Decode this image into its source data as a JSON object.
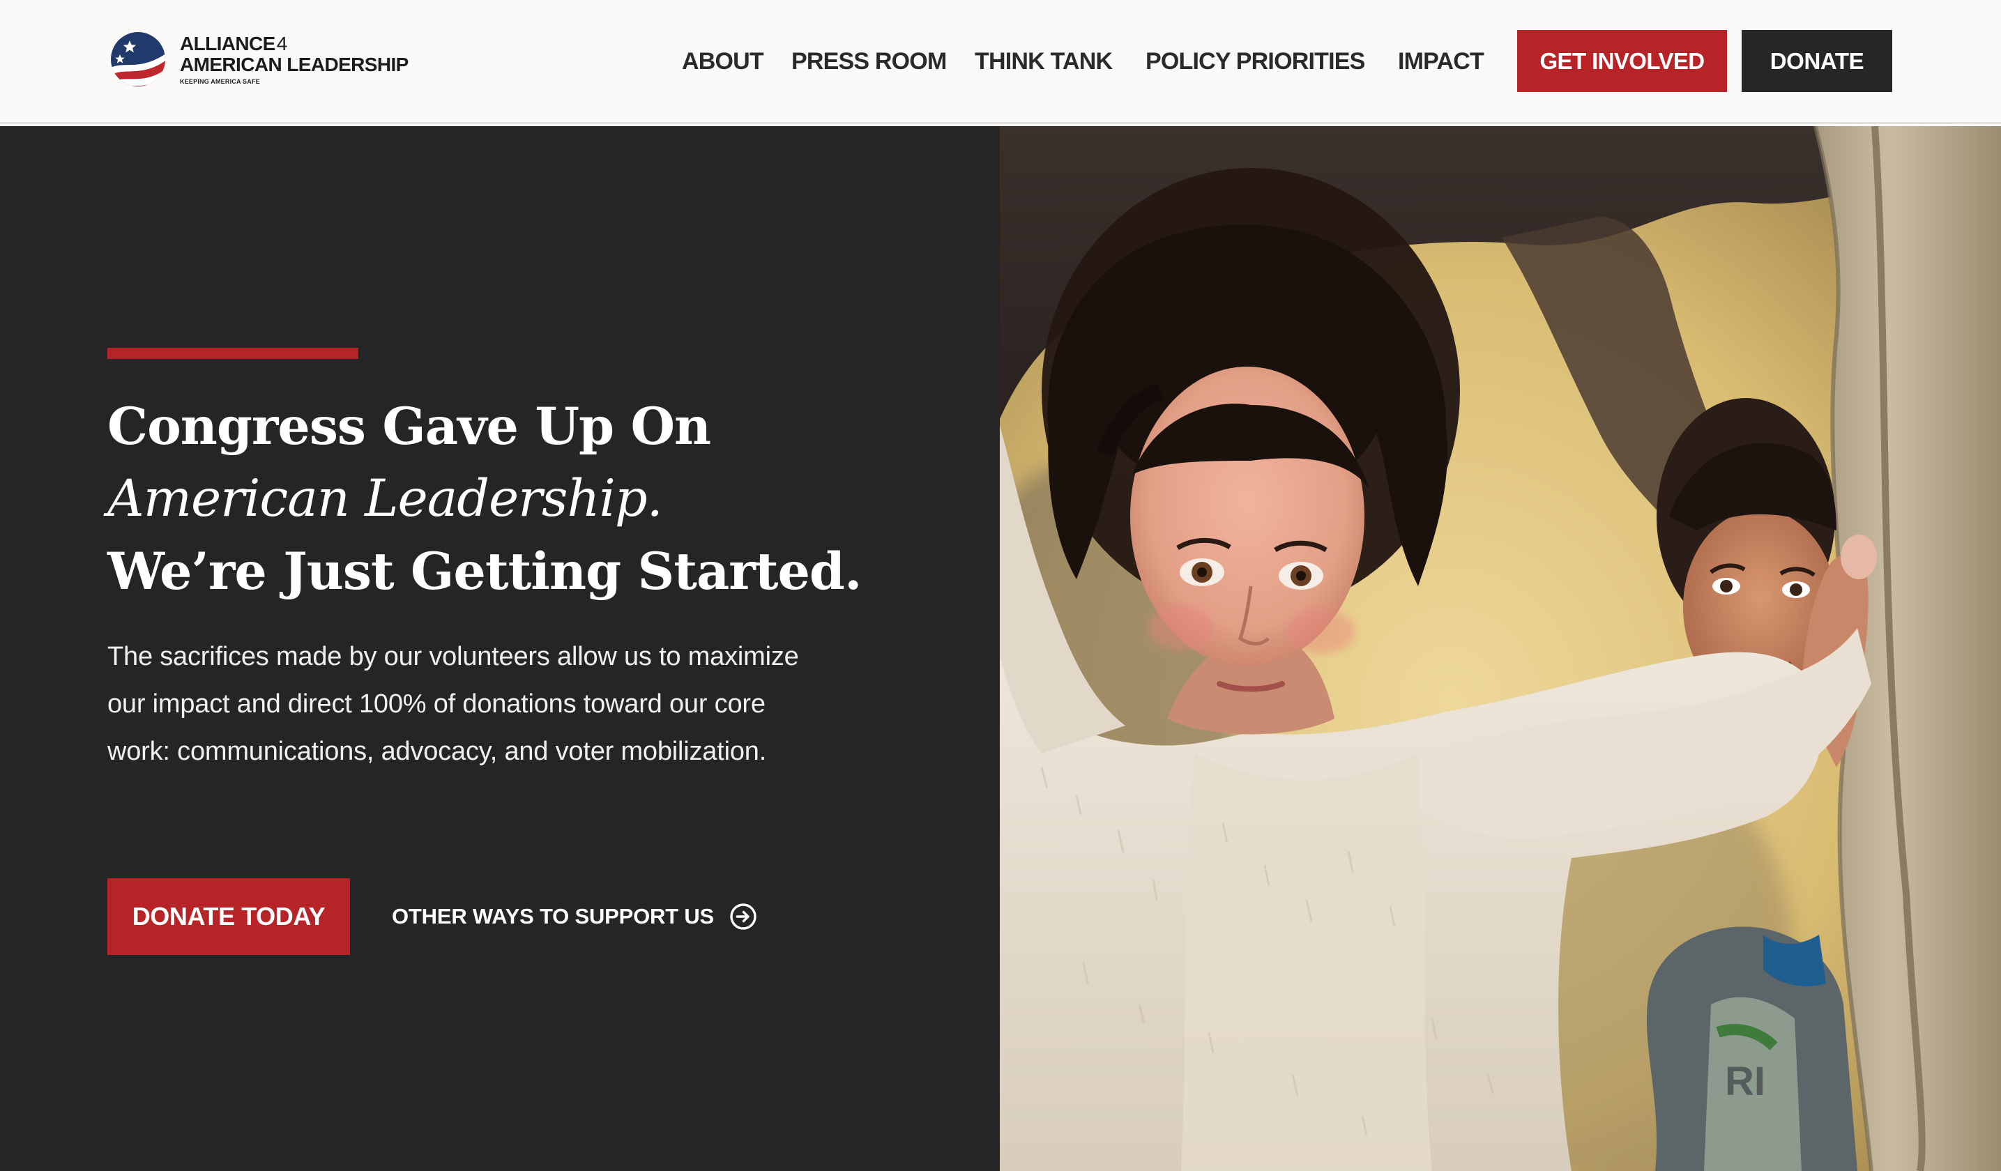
{
  "brand": {
    "line1": "ALLIANCE",
    "line1_num": "4",
    "line2": "AMERICAN LEADERSHIP",
    "tagline": "KEEPING AMERICA SAFE",
    "colors": {
      "red": "#b72428",
      "navy": "#1f3a6b",
      "dark": "#262525"
    }
  },
  "nav": {
    "items": [
      {
        "label": "ABOUT"
      },
      {
        "label": "PRESS ROOM"
      },
      {
        "label": "THINK TANK"
      },
      {
        "label": "POLICY PRIORITIES"
      },
      {
        "label": "IMPACT"
      }
    ],
    "get_involved": "GET INVOLVED",
    "donate": "DONATE"
  },
  "hero": {
    "headline_1": "Congress Gave Up On",
    "headline_2": "American Leadership.",
    "headline_3": "We’re Just Getting Started.",
    "body": "The sacrifices made by our volunteers allow us to maximize our impact and direct 100% of donations toward our core work: communications, advocacy, and voter mobilization.",
    "cta_primary": "DONATE TODAY",
    "cta_secondary": "OTHER WAYS TO SUPPORT US",
    "cta_secondary_icon": "arrow-circle-right-icon",
    "photo_alt": "Two children at the entrance of a tent",
    "photo_shirt_text": "RI"
  }
}
